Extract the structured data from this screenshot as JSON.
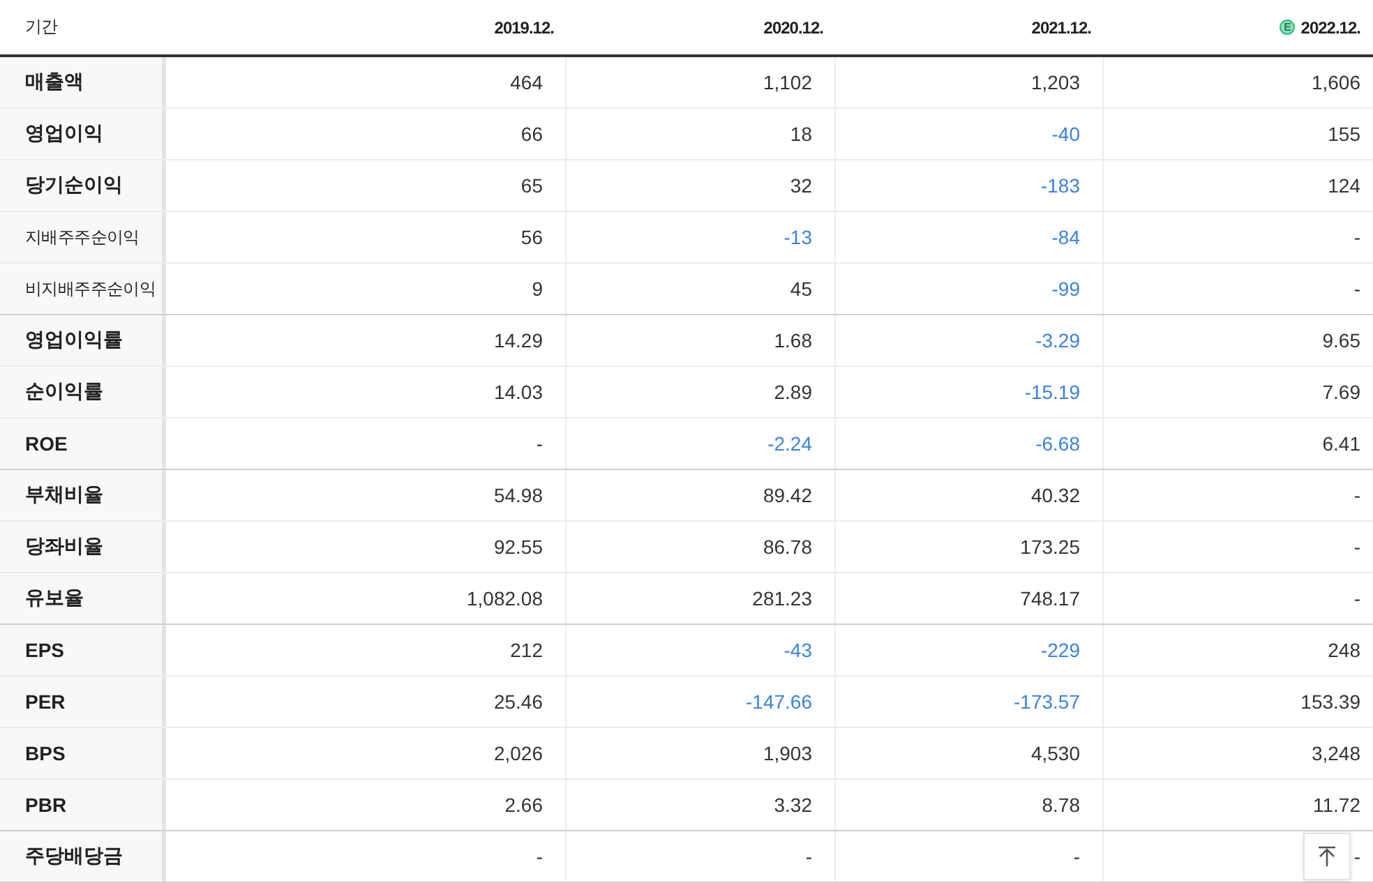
{
  "table": {
    "columns": [
      {
        "label": "기간"
      },
      {
        "label": "2019.12."
      },
      {
        "label": "2020.12."
      },
      {
        "label": "2021.12."
      },
      {
        "label": "2022.12.",
        "badge": "E"
      }
    ],
    "groups": [
      {
        "rows": [
          {
            "label": "매출액",
            "kind": "main",
            "cells": [
              {
                "value": "464",
                "negative": false
              },
              {
                "value": "1,102",
                "negative": false
              },
              {
                "value": "1,203",
                "negative": false
              },
              {
                "value": "1,606",
                "negative": false
              }
            ]
          },
          {
            "label": "영업이익",
            "kind": "main",
            "cells": [
              {
                "value": "66",
                "negative": false
              },
              {
                "value": "18",
                "negative": false
              },
              {
                "value": "-40",
                "negative": true
              },
              {
                "value": "155",
                "negative": false
              }
            ]
          },
          {
            "label": "당기순이익",
            "kind": "main",
            "cells": [
              {
                "value": "65",
                "negative": false
              },
              {
                "value": "32",
                "negative": false
              },
              {
                "value": "-183",
                "negative": true
              },
              {
                "value": "124",
                "negative": false
              }
            ]
          },
          {
            "label": "지배주주순이익",
            "kind": "sub",
            "cells": [
              {
                "value": "56",
                "negative": false
              },
              {
                "value": "-13",
                "negative": true
              },
              {
                "value": "-84",
                "negative": true
              },
              {
                "value": "-",
                "negative": false
              }
            ]
          },
          {
            "label": "비지배주주순이익",
            "kind": "sub",
            "cells": [
              {
                "value": "9",
                "negative": false
              },
              {
                "value": "45",
                "negative": false
              },
              {
                "value": "-99",
                "negative": true
              },
              {
                "value": "-",
                "negative": false
              }
            ]
          }
        ]
      },
      {
        "rows": [
          {
            "label": "영업이익률",
            "kind": "main",
            "cells": [
              {
                "value": "14.29",
                "negative": false
              },
              {
                "value": "1.68",
                "negative": false
              },
              {
                "value": "-3.29",
                "negative": true
              },
              {
                "value": "9.65",
                "negative": false
              }
            ]
          },
          {
            "label": "순이익률",
            "kind": "main",
            "cells": [
              {
                "value": "14.03",
                "negative": false
              },
              {
                "value": "2.89",
                "negative": false
              },
              {
                "value": "-15.19",
                "negative": true
              },
              {
                "value": "7.69",
                "negative": false
              }
            ]
          },
          {
            "label": "ROE",
            "kind": "main",
            "cells": [
              {
                "value": "-",
                "negative": false
              },
              {
                "value": "-2.24",
                "negative": true
              },
              {
                "value": "-6.68",
                "negative": true
              },
              {
                "value": "6.41",
                "negative": false
              }
            ]
          }
        ]
      },
      {
        "rows": [
          {
            "label": "부채비율",
            "kind": "main",
            "cells": [
              {
                "value": "54.98",
                "negative": false
              },
              {
                "value": "89.42",
                "negative": false
              },
              {
                "value": "40.32",
                "negative": false
              },
              {
                "value": "-",
                "negative": false
              }
            ]
          },
          {
            "label": "당좌비율",
            "kind": "main",
            "cells": [
              {
                "value": "92.55",
                "negative": false
              },
              {
                "value": "86.78",
                "negative": false
              },
              {
                "value": "173.25",
                "negative": false
              },
              {
                "value": "-",
                "negative": false
              }
            ]
          },
          {
            "label": "유보율",
            "kind": "main",
            "cells": [
              {
                "value": "1,082.08",
                "negative": false
              },
              {
                "value": "281.23",
                "negative": false
              },
              {
                "value": "748.17",
                "negative": false
              },
              {
                "value": "-",
                "negative": false
              }
            ]
          }
        ]
      },
      {
        "rows": [
          {
            "label": "EPS",
            "kind": "main",
            "cells": [
              {
                "value": "212",
                "negative": false
              },
              {
                "value": "-43",
                "negative": true
              },
              {
                "value": "-229",
                "negative": true
              },
              {
                "value": "248",
                "negative": false
              }
            ]
          },
          {
            "label": "PER",
            "kind": "main",
            "cells": [
              {
                "value": "25.46",
                "negative": false
              },
              {
                "value": "-147.66",
                "negative": true
              },
              {
                "value": "-173.57",
                "negative": true
              },
              {
                "value": "153.39",
                "negative": false
              }
            ]
          },
          {
            "label": "BPS",
            "kind": "main",
            "cells": [
              {
                "value": "2,026",
                "negative": false
              },
              {
                "value": "1,903",
                "negative": false
              },
              {
                "value": "4,530",
                "negative": false
              },
              {
                "value": "3,248",
                "negative": false
              }
            ]
          },
          {
            "label": "PBR",
            "kind": "main",
            "cells": [
              {
                "value": "2.66",
                "negative": false
              },
              {
                "value": "3.32",
                "negative": false
              },
              {
                "value": "8.78",
                "negative": false
              },
              {
                "value": "11.72",
                "negative": false
              }
            ]
          }
        ]
      },
      {
        "rows": [
          {
            "label": "주당배당금",
            "kind": "main",
            "cells": [
              {
                "value": "-",
                "negative": false
              },
              {
                "value": "-",
                "negative": false
              },
              {
                "value": "-",
                "negative": false
              },
              {
                "value": "-",
                "negative": false
              }
            ]
          }
        ]
      }
    ]
  }
}
